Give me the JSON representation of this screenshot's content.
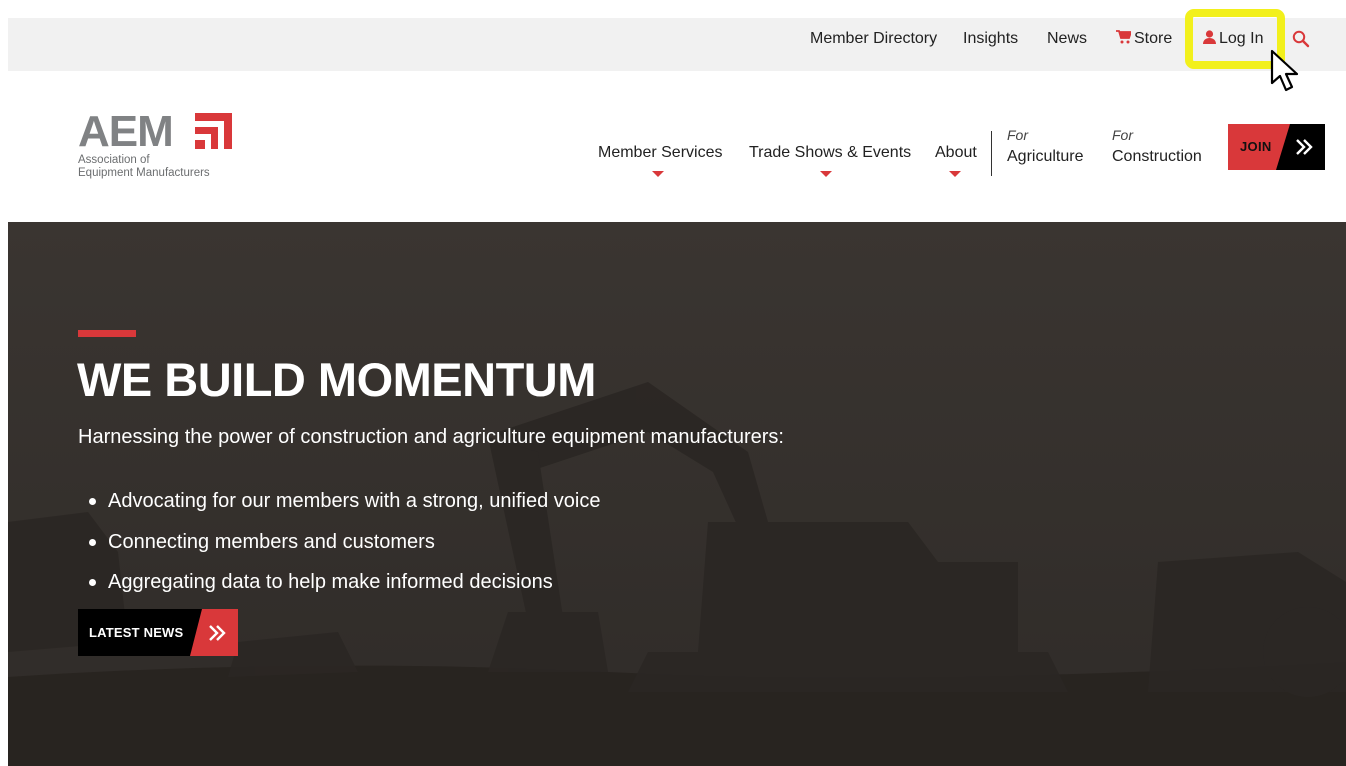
{
  "utility_nav": {
    "member_directory": "Member Directory",
    "insights": "Insights",
    "news": "News",
    "store": "Store",
    "login": "Log In",
    "store_icon": "cart-icon",
    "login_icon": "user-icon",
    "search_icon": "search-icon"
  },
  "logo": {
    "wordmark": "AEM",
    "subtitle_line1": "Association of",
    "subtitle_line2": "Equipment Manufacturers"
  },
  "main_nav": {
    "member_services": "Member Services",
    "trade_shows": "Trade Shows & Events",
    "about": "About",
    "agriculture_for": "For",
    "agriculture": "Agriculture",
    "construction_for": "For",
    "construction": "Construction",
    "join": "JOIN"
  },
  "hero": {
    "headline": "WE BUILD MOMENTUM",
    "intro": "Harnessing the power of construction and agriculture equipment manufacturers:",
    "bullets": [
      "Advocating for our members with a strong, unified voice",
      "Connecting members and customers",
      "Aggregating data to help make informed decisions"
    ],
    "cta": "LATEST NEWS"
  },
  "colors": {
    "brand_red": "#d9383a",
    "highlight_yellow": "#f2f01c",
    "hero_bg": "#34302c",
    "topbar_bg": "#f1f1f1"
  }
}
